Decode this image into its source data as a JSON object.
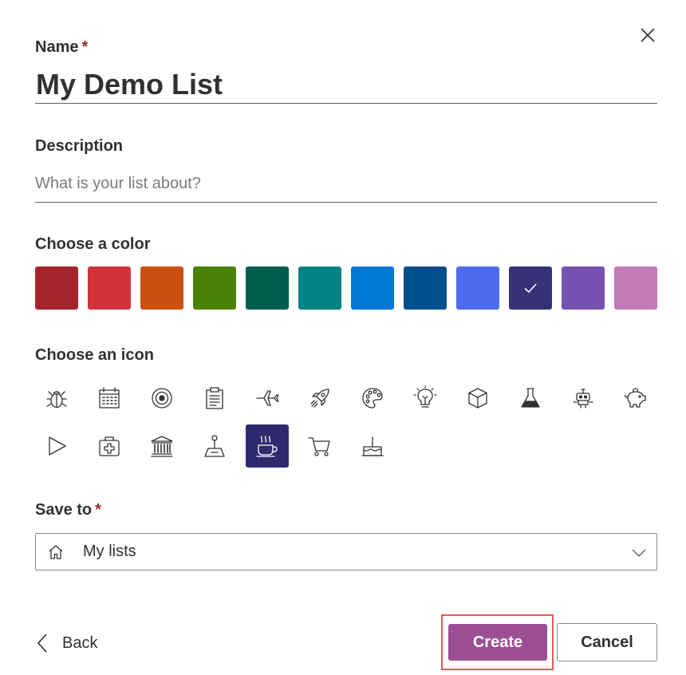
{
  "form": {
    "name_label": "Name",
    "name_required": "*",
    "name_value": "My Demo List",
    "description_label": "Description",
    "description_placeholder": "What is your list about?",
    "color_label": "Choose a color",
    "icon_label": "Choose an icon",
    "save_label": "Save to",
    "save_required": "*",
    "save_value": "My lists"
  },
  "colors": [
    {
      "name": "dark-red",
      "hex": "#a4262c",
      "selected": false
    },
    {
      "name": "red",
      "hex": "#d13438",
      "selected": false
    },
    {
      "name": "orange",
      "hex": "#ca5010",
      "selected": false
    },
    {
      "name": "green",
      "hex": "#498205",
      "selected": false
    },
    {
      "name": "dark-teal",
      "hex": "#005e50",
      "selected": false
    },
    {
      "name": "teal",
      "hex": "#038387",
      "selected": false
    },
    {
      "name": "blue",
      "hex": "#0078d4",
      "selected": false
    },
    {
      "name": "dark-blue",
      "hex": "#004e8c",
      "selected": false
    },
    {
      "name": "periwinkle",
      "hex": "#4f6bed",
      "selected": false
    },
    {
      "name": "indigo",
      "hex": "#373277",
      "selected": true
    },
    {
      "name": "purple",
      "hex": "#7551b1",
      "selected": false
    },
    {
      "name": "orchid",
      "hex": "#c27ab8",
      "selected": false
    }
  ],
  "icons": [
    {
      "name": "bug-icon",
      "selected": false
    },
    {
      "name": "calendar-icon",
      "selected": false
    },
    {
      "name": "target-icon",
      "selected": false
    },
    {
      "name": "clipboard-icon",
      "selected": false
    },
    {
      "name": "airplane-icon",
      "selected": false
    },
    {
      "name": "rocket-icon",
      "selected": false
    },
    {
      "name": "palette-icon",
      "selected": false
    },
    {
      "name": "lightbulb-icon",
      "selected": false
    },
    {
      "name": "cube-icon",
      "selected": false
    },
    {
      "name": "flask-icon",
      "selected": false
    },
    {
      "name": "robot-icon",
      "selected": false
    },
    {
      "name": "piggy-bank-icon",
      "selected": false
    },
    {
      "name": "play-triangle-icon",
      "selected": false
    },
    {
      "name": "medical-kit-icon",
      "selected": false
    },
    {
      "name": "bank-icon",
      "selected": false
    },
    {
      "name": "joystick-icon",
      "selected": false
    },
    {
      "name": "coffee-cup-icon",
      "selected": true
    },
    {
      "name": "shopping-cart-icon",
      "selected": false
    },
    {
      "name": "cake-icon",
      "selected": false
    }
  ],
  "footer": {
    "back_label": "Back",
    "create_label": "Create",
    "cancel_label": "Cancel"
  },
  "theme": {
    "accent": "#9c4f92",
    "selected_icon_bg": "#2f2a6e",
    "required_color": "#a4262c",
    "highlight_border": "#e85a5a"
  }
}
